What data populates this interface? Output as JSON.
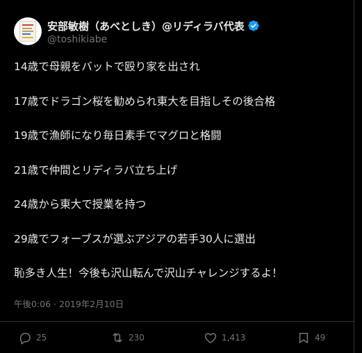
{
  "author": {
    "display_name": "安部敏樹（あべとしき）@リディラバ代表",
    "handle": "@toshikiabe",
    "verified": true,
    "avatar_icon": "book-cover-avatar"
  },
  "tweet": {
    "lines": [
      "14歳で母親をバットで殴り家を出され",
      "17歳でドラゴン桜を勧められ東大を目指しその後合格",
      "19歳で漁師になり毎日素手でマグロと格闘",
      "21歳で仲間とリディラバ立ち上げ",
      "24歳から東大で授業を持つ",
      "29歳でフォーブスが選ぶアジアの若手30人に選出",
      "恥多き人生！今後も沢山転んで沢山チャレンジするよ！"
    ],
    "timestamp": "午後0:06 · 2019年2月10日"
  },
  "actions": {
    "reply": {
      "icon": "reply-icon",
      "count": "25"
    },
    "retweet": {
      "icon": "retweet-icon",
      "count": "230"
    },
    "like": {
      "icon": "heart-icon",
      "count": "1,413"
    },
    "bookmark": {
      "icon": "bookmark-icon",
      "count": "49"
    }
  },
  "colors": {
    "background": "#000000",
    "text_primary": "#e7e9ea",
    "text_secondary": "#71767b",
    "verified_blue": "#1d9bf0",
    "divider": "#2f3336"
  }
}
